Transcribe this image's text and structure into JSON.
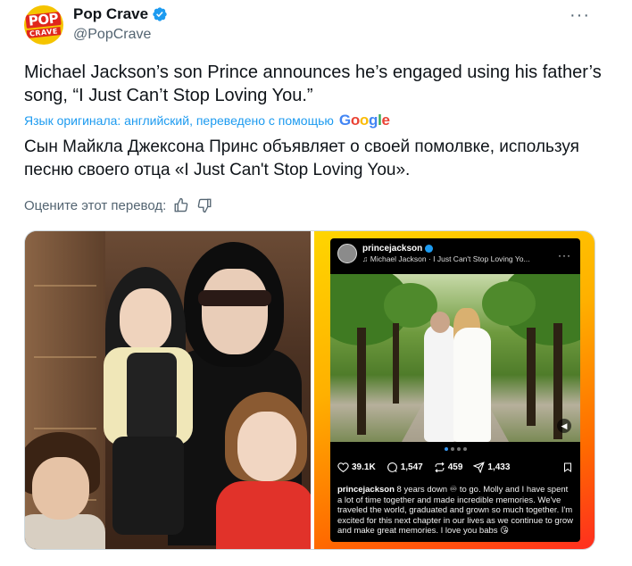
{
  "author": {
    "display_name": "Pop Crave",
    "handle": "@PopCrave",
    "avatar_text_top": "POP",
    "avatar_text_bottom": "CRAVE",
    "verified_color": "#1d9bf0"
  },
  "more_icon": "more-horizontal-icon",
  "tweet": {
    "text": "Michael Jackson’s son Prince announces he’s engaged using his father’s song, “I Just Can’t Stop Loving You.”",
    "translation_note": "Язык оригинала: английский, переведено с помощью",
    "translation_provider": "Google",
    "translated_text": "Сын Майкла Джексона Принс объявляет о своей помолвке, используя песню своего отца «I Just Can't Stop Loving You».",
    "rate_prompt": "Оцените этот перевод:"
  },
  "instagram": {
    "username": "princejackson",
    "song": "Michael Jackson · I Just Can't Stop Loving Yo...",
    "likes": "39.1K",
    "comments": "1,547",
    "reposts": "459",
    "shares": "1,433",
    "caption_user": "princejackson",
    "caption_text": " 8 years down ♾ to go. Molly and I have spent a lot of time together and made incredible memories. We've traveled the world, graduated and grown so much together. I'm excited for this next chapter in our lives as we continue to grow and make great memories. I love you babs 😘",
    "carousel_active": 1
  },
  "colors": {
    "link_blue": "#1d9bf0",
    "secondary_text": "#536471",
    "brand_yellow": "#f5c400",
    "brand_red": "#e0261d"
  }
}
